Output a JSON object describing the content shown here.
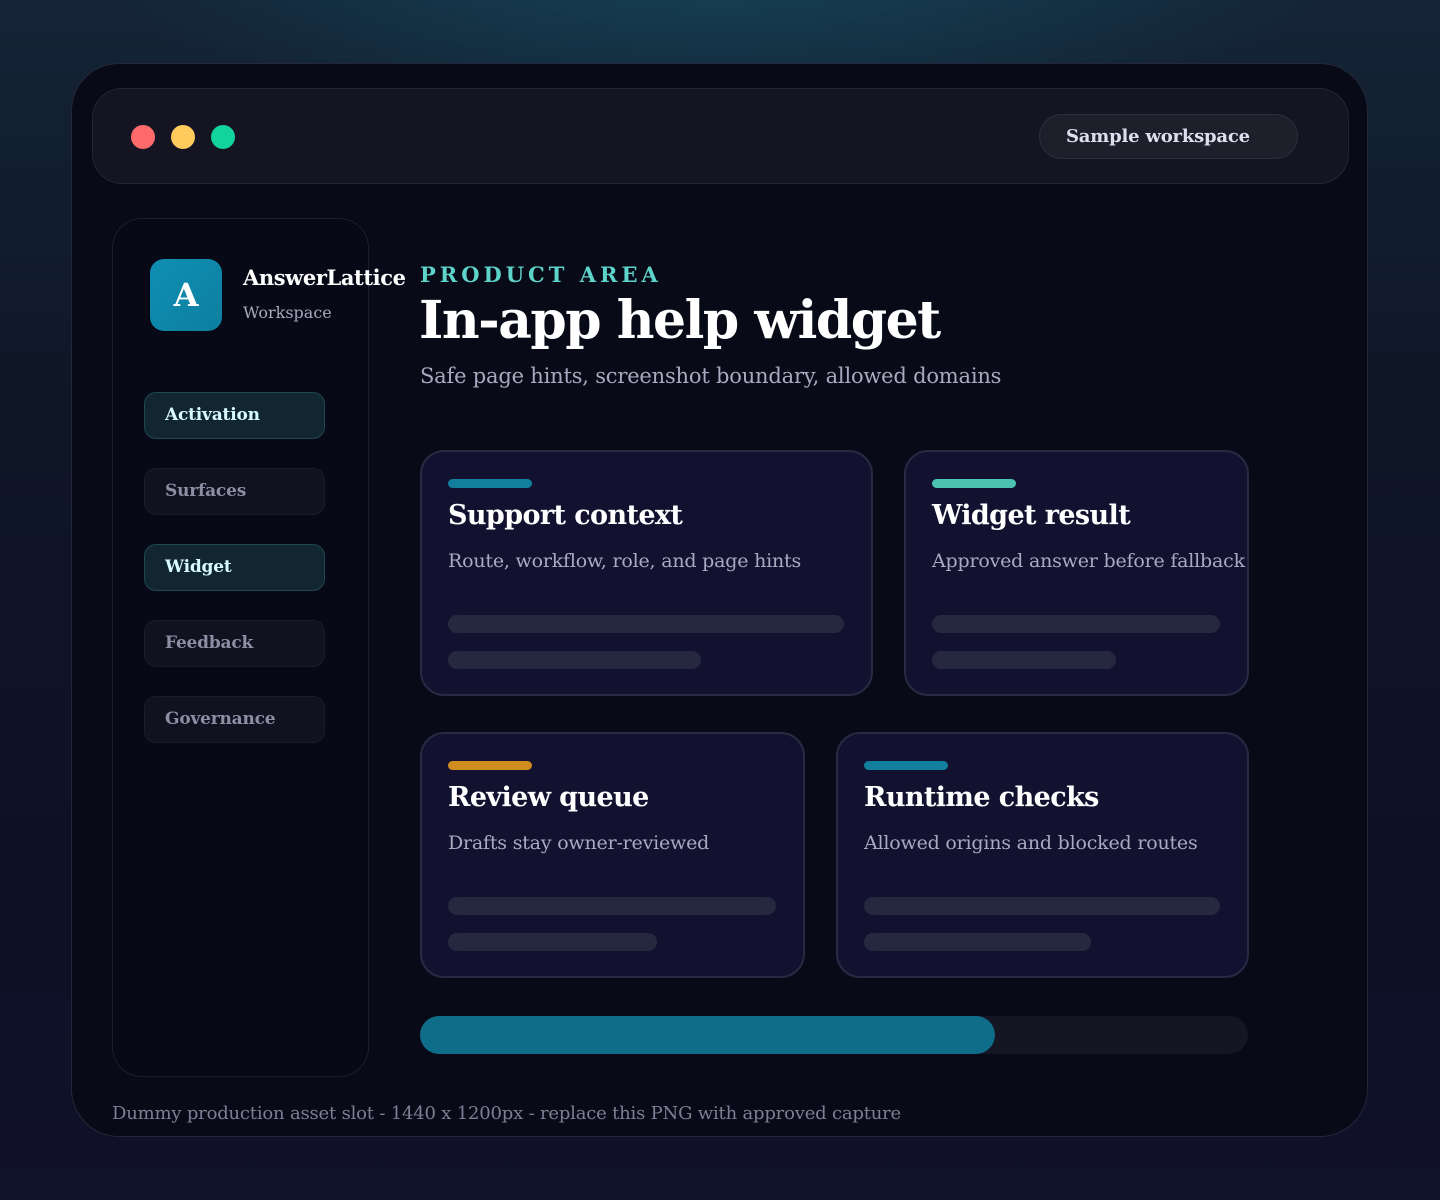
{
  "window": {
    "controls": [
      {
        "name": "close",
        "color": "#ff6b6b"
      },
      {
        "name": "minimize",
        "color": "#ffcb5c"
      },
      {
        "name": "maximize",
        "color": "#12d39b"
      }
    ],
    "workspace_label": "Sample workspace"
  },
  "sidebar": {
    "logo_letter": "A",
    "brand_name": "AnswerLattice",
    "brand_sub": "Workspace",
    "items": [
      {
        "label": "Activation",
        "active": true
      },
      {
        "label": "Surfaces",
        "active": false
      },
      {
        "label": "Widget",
        "active": true
      },
      {
        "label": "Feedback",
        "active": false
      },
      {
        "label": "Governance",
        "active": false
      }
    ]
  },
  "main": {
    "eyebrow": "PRODUCT AREA",
    "title": "In-app help widget",
    "subtitle": "Safe page hints, screenshot boundary, allowed domains",
    "cards": [
      {
        "title": "Support context",
        "description": "Route, workflow, role, and page hints",
        "accent": "#12809d"
      },
      {
        "title": "Widget result",
        "description": "Approved answer before fallback",
        "accent": "#4cc2b0"
      },
      {
        "title": "Review queue",
        "description": "Drafts stay owner-reviewed",
        "accent": "#d08c1e"
      },
      {
        "title": "Runtime checks",
        "description": "Allowed origins and blocked routes",
        "accent": "#12809d"
      }
    ],
    "progress": 0.695
  },
  "footnote": "Dummy production asset slot - 1440 x 1200px - replace this PNG with approved capture"
}
